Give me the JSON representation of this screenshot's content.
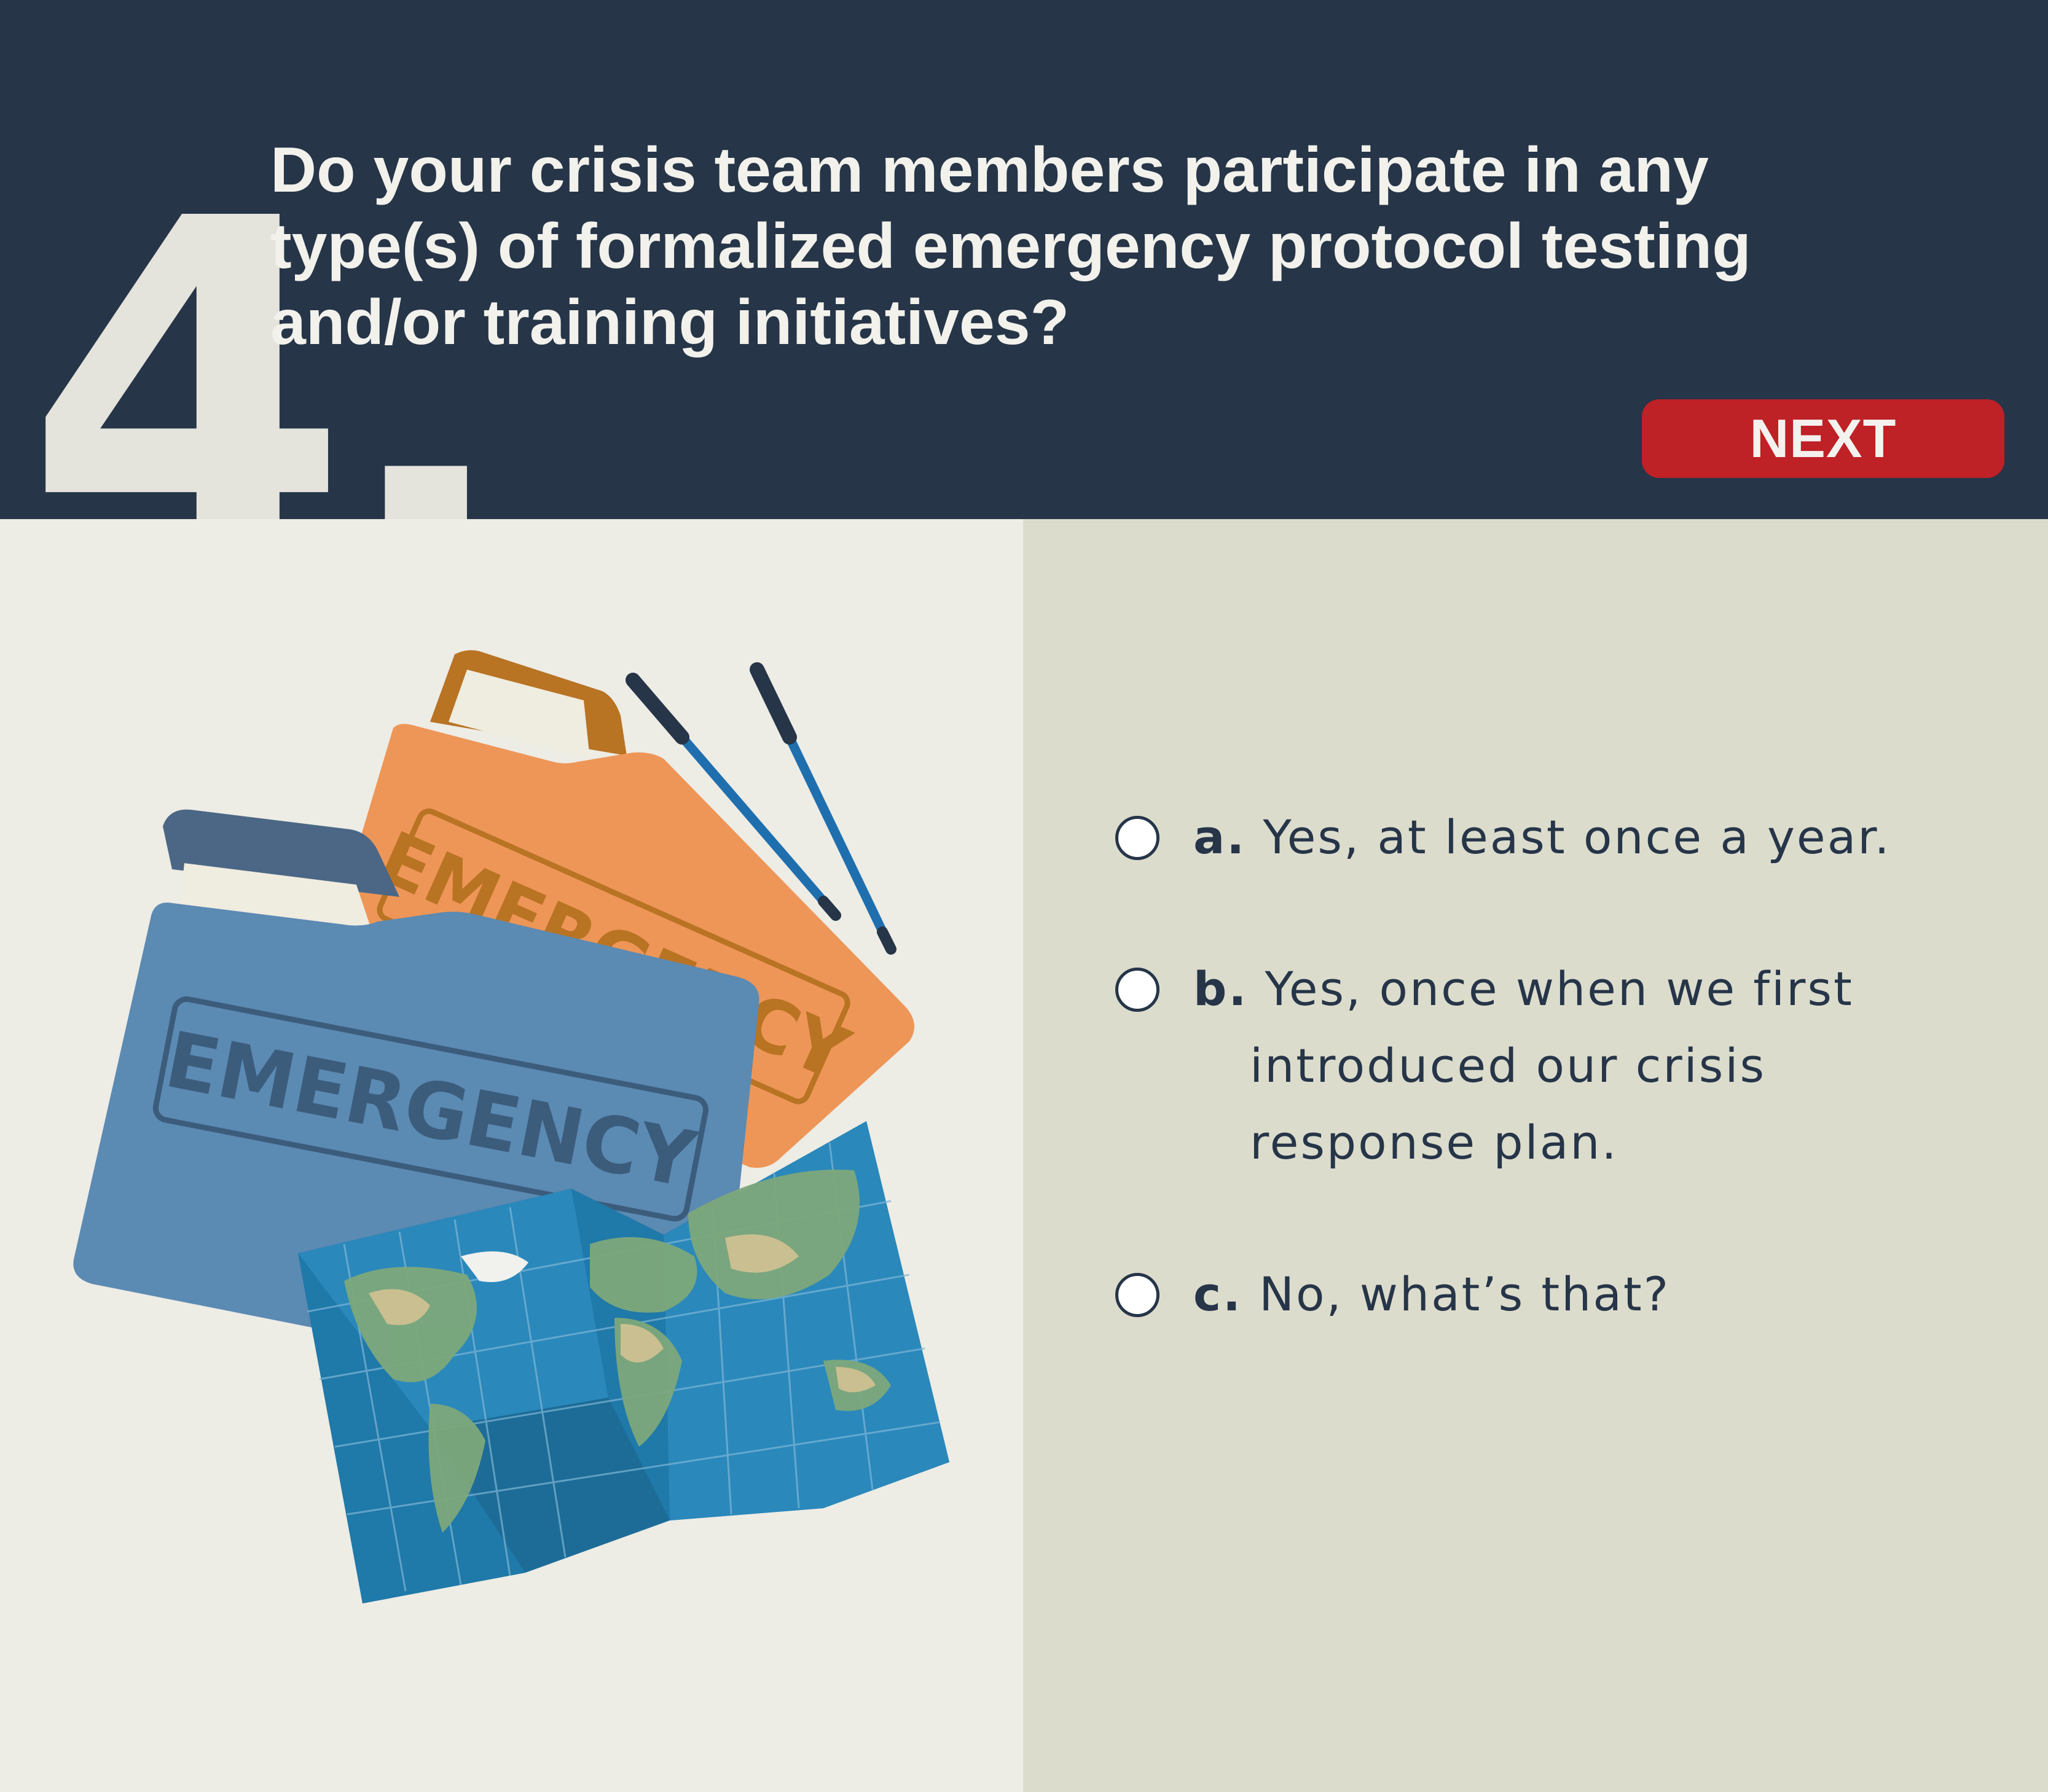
{
  "header": {
    "question_number": "4.",
    "question_text": "Do your crisis team members participate in any type(s) of formalized emergency protocol testing and/or training initiatives?",
    "next_label": "NEXT"
  },
  "illustration": {
    "back_folder_stamp": "EMERGENCY",
    "front_folder_stamp": "EMERGENCY"
  },
  "options": [
    {
      "letter": "a.",
      "line1": "Yes, at least once a year.",
      "rest": []
    },
    {
      "letter": "b.",
      "line1": "Yes, once when we first",
      "rest": [
        "introduced our crisis",
        "response plan."
      ]
    },
    {
      "letter": "c.",
      "line1": "No, what’s that?",
      "rest": []
    }
  ],
  "colors": {
    "header_bg": "#263548",
    "next_button": "#be2126",
    "left_bg": "#edece5",
    "right_bg": "#dcdccd",
    "text_dark": "#263548"
  }
}
